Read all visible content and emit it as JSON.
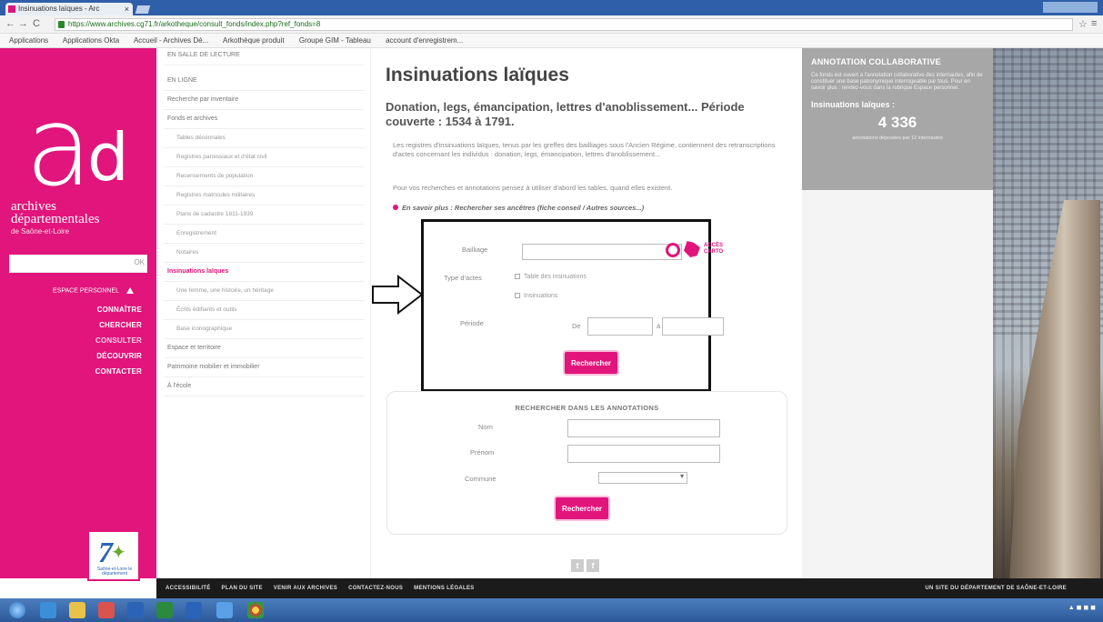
{
  "browser": {
    "tab_title": "Insinuations laïques - Arc",
    "url": "https://www.archives.cg71.fr/arkotheque/consult_fonds/index.php?ref_fonds=8",
    "bookmarks": [
      "Applications",
      "Applications Okta",
      "Accueil - Archives Dé...",
      "Arkothèque produit",
      "Groupe GIM - Tableau",
      "account d'enregistrem..."
    ]
  },
  "sidebar": {
    "logo_a": "a",
    "logo_d": "d",
    "brand_line1": "archives",
    "brand_line2": "départementales",
    "brand_line3": "de Saône-et-Loire",
    "search_ok": "OK",
    "small_link": "ESPACE PERSONNEL",
    "nav": [
      "CONNAÎTRE",
      "CHERCHER",
      "CONSULTER",
      "DÉCOUVRIR",
      "CONTACTER"
    ],
    "region_text": "Saône-et-Loire le département"
  },
  "nav2": {
    "items": [
      {
        "label": "EN SALLE DE LECTURE",
        "kind": "item"
      },
      {
        "label": "EN LIGNE",
        "kind": "item"
      },
      {
        "label": "Recherche par inventaire",
        "kind": "item"
      },
      {
        "label": "Fonds et archives",
        "kind": "item"
      },
      {
        "label": "Tables décennales",
        "kind": "sub"
      },
      {
        "label": "Registres paroissiaux et d'état civil",
        "kind": "sub"
      },
      {
        "label": "Recensements de population",
        "kind": "sub"
      },
      {
        "label": "Registres matricules militaires",
        "kind": "sub"
      },
      {
        "label": "Plans de cadastre 1811-1939",
        "kind": "sub"
      },
      {
        "label": "Enregistrement",
        "kind": "sub"
      },
      {
        "label": "Notaires",
        "kind": "sub"
      },
      {
        "label": "Insinuations laïques",
        "kind": "sel"
      },
      {
        "label": "Une femme, une histoire, un héritage",
        "kind": "sub"
      },
      {
        "label": "Écrits édifiants et outils",
        "kind": "sub"
      },
      {
        "label": "Base iconographique",
        "kind": "sub"
      },
      {
        "label": "Espace et territoire",
        "kind": "item"
      },
      {
        "label": "Patrimoine mobilier et immobilier",
        "kind": "item"
      },
      {
        "label": "À l'école",
        "kind": "item"
      }
    ]
  },
  "main": {
    "title": "Insinuations laïques",
    "subtitle": "Donation, legs, émancipation, lettres d'anoblissement... Période couverte : 1534 à 1791.",
    "intro": "Les registres d'insinuations laïques, tenus par les greffes des bailliages sous l'Ancien Régime, contiennent des retranscriptions d'actes concernant les individus : donation, legs, émancipation, lettres d'anoblissement...",
    "intro2": "Pour vos recherches et annotations pensez à utiliser d'abord les tables, quand elles existent.",
    "more_link": "En savoir plus : Rechercher ses ancêtres (fiche conseil / Autres sources...)",
    "form": {
      "bailliage_label": "Bailliage",
      "type_label": "Type d'actes",
      "type_opt1": "Table des insinuations",
      "type_opt2": "Insinuations",
      "periode_label": "Période",
      "de_label": "De",
      "a_label": "à",
      "submit": "Rechercher"
    },
    "carto": "ACCÈS CARTO",
    "annot": {
      "title": "RECHERCHER DANS LES ANNOTATIONS",
      "nom_label": "Nom",
      "prenom_label": "Prénom",
      "commune_label": "Commune",
      "submit": "Rechercher"
    },
    "social": [
      "t",
      "f"
    ]
  },
  "annotation_panel": {
    "title": "ANNOTATION COLLABORATIVE",
    "desc": "Ce fonds est ouvert à l'annotation collaborative des internautes, afin de constituer une base patronymique interrogeable par tous. Pour en savoir plus : rendez-vous dans la rubrique Espace personnel.",
    "label": "Insinuations laïques :",
    "count": "4 336",
    "caption": "annotations déposées par 12 internautes"
  },
  "footer": {
    "links": [
      "ACCESSIBILITÉ",
      "PLAN DU SITE",
      "VENIR AUX ARCHIVES",
      "CONTACTEZ-NOUS",
      "MENTIONS LÉGALES"
    ],
    "right": "UN SITE DU DÉPARTEMENT DE SAÔNE-ET-LOIRE"
  },
  "colors": {
    "brand_pink": "#e1157b",
    "panel_grey": "#a7a7a7"
  }
}
